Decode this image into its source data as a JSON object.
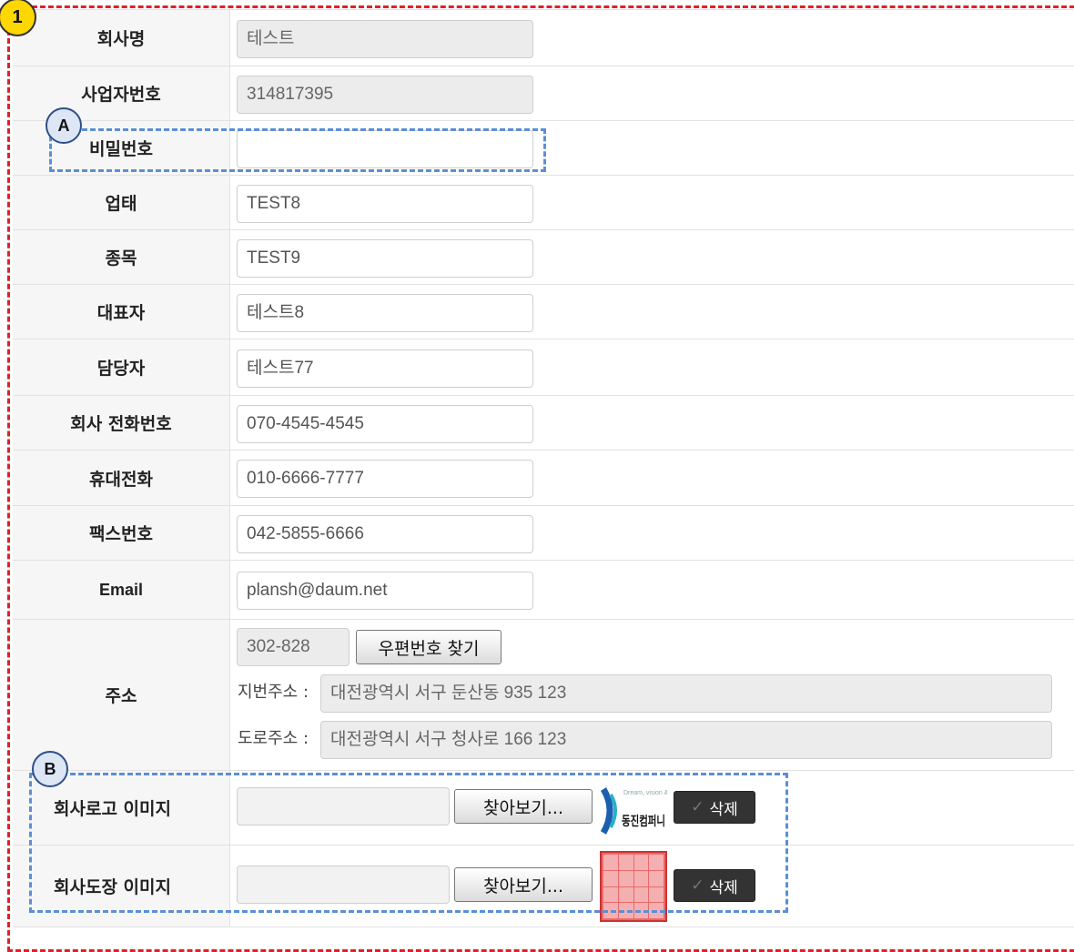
{
  "badges": {
    "main": "1",
    "a": "A",
    "b": "B"
  },
  "fields": {
    "company_name": {
      "label": "회사명",
      "value": "테스트"
    },
    "biz_number": {
      "label": "사업자번호",
      "value": "314817395"
    },
    "password": {
      "label": "비밀번호",
      "value": ""
    },
    "business_type": {
      "label": "업태",
      "value": "TEST8"
    },
    "business_item": {
      "label": "종목",
      "value": "TEST9"
    },
    "representative": {
      "label": "대표자",
      "value": "테스트8"
    },
    "contact_person": {
      "label": "담당자",
      "value": "테스트77"
    },
    "company_phone": {
      "label": "회사 전화번호",
      "value": "070-4545-4545"
    },
    "mobile": {
      "label": "휴대전화",
      "value": "010-6666-7777"
    },
    "fax": {
      "label": "팩스번호",
      "value": "042-5855-6666"
    },
    "email": {
      "label": "Email",
      "value": "plansh@daum.net"
    }
  },
  "address": {
    "label": "주소",
    "postal_code": "302-828",
    "find_postal_button": "우편번호 찾기",
    "lot_label": "지번주소 :",
    "lot_value": "대전광역시 서구 둔산동 935 123",
    "road_label": "도로주소 :",
    "road_value": "대전광역시 서구 청사로 166 123"
  },
  "images": {
    "logo": {
      "label": "회사로고 이미지",
      "browse_button": "찾아보기...",
      "delete_button": "삭제",
      "logo_text": "동진컴퍼니"
    },
    "seal": {
      "label": "회사도장 이미지",
      "browse_button": "찾아보기...",
      "delete_button": "삭제"
    }
  },
  "colors": {
    "outer_dash": "#e0202a",
    "section_dash": "#5b8fd6",
    "badge_main": "#ffd700",
    "badge_section": "#dce6f4",
    "seal": "#e86a6a"
  }
}
